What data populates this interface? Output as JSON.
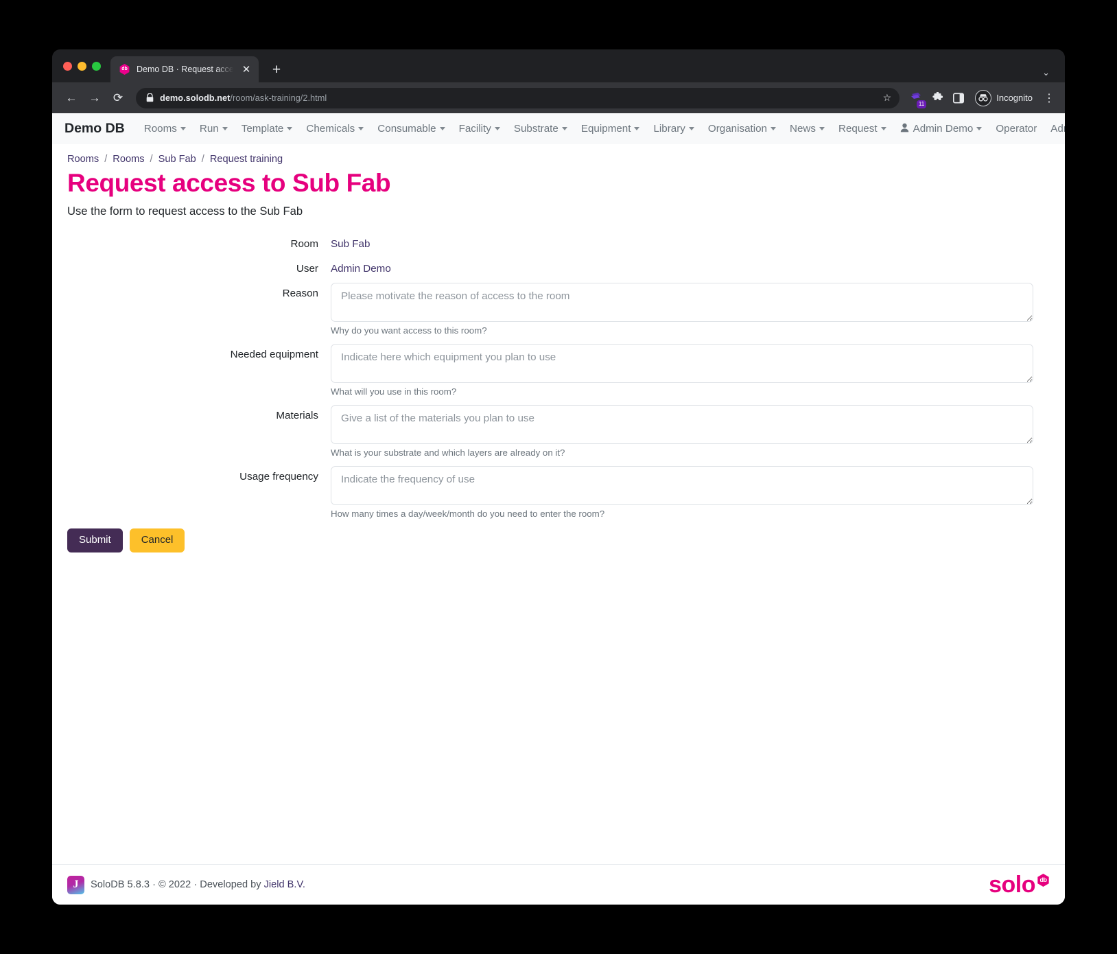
{
  "browser": {
    "tab": {
      "title": "Demo DB · Request access to S",
      "favicon": "solodb-icon",
      "close_label": "✕"
    },
    "new_tab_label": "+",
    "tabstrip_chevron": "⌄",
    "toolbar": {
      "back": "←",
      "forward": "→",
      "reload": "⟳",
      "url_bold": "demo.solodb.net",
      "url_rest": "/room/ask-training/2.html",
      "bookmark": "☆",
      "extension_badge": "11",
      "incognito_label": "Incognito",
      "menu": "⋮"
    }
  },
  "navbar": {
    "brand": "Demo DB",
    "items": [
      {
        "label": "Rooms",
        "caret": true
      },
      {
        "label": "Run",
        "caret": true
      },
      {
        "label": "Template",
        "caret": true
      },
      {
        "label": "Chemicals",
        "caret": true
      },
      {
        "label": "Consumable",
        "caret": true
      },
      {
        "label": "Facility",
        "caret": true
      },
      {
        "label": "Substrate",
        "caret": true
      },
      {
        "label": "Equipment",
        "caret": true
      },
      {
        "label": "Library",
        "caret": true
      },
      {
        "label": "Organisation",
        "caret": true
      },
      {
        "label": "News",
        "caret": true
      },
      {
        "label": "Request",
        "caret": true
      }
    ],
    "right_items": [
      {
        "label": "Admin Demo",
        "caret": true,
        "icon": "person-icon"
      },
      {
        "label": "Operator",
        "caret": false
      },
      {
        "label": "Admin",
        "caret": false
      }
    ]
  },
  "breadcrumb": [
    "Rooms",
    "Rooms",
    "Sub Fab",
    "Request training"
  ],
  "page": {
    "title": "Request access to Sub Fab",
    "subtitle": "Use the form to request access to the Sub Fab",
    "title_color": "#e6007e"
  },
  "form": {
    "rows": [
      {
        "label": "Room",
        "type": "static",
        "value": "Sub Fab"
      },
      {
        "label": "User",
        "type": "static",
        "value": "Admin Demo"
      },
      {
        "label": "Reason",
        "type": "textarea",
        "value": "",
        "placeholder": "Please motivate the reason of access to the room",
        "help": "Why do you want access to this room?"
      },
      {
        "label": "Needed equipment",
        "type": "textarea",
        "value": "",
        "placeholder": "Indicate here which equipment you plan to use",
        "help": "What will you use in this room?"
      },
      {
        "label": "Materials",
        "type": "textarea",
        "value": "",
        "placeholder": "Give a list of the materials you plan to use",
        "help": "What is your substrate and which layers are already on it?"
      },
      {
        "label": "Usage frequency",
        "type": "textarea",
        "value": "",
        "placeholder": "Indicate the frequency of use",
        "help": "How many times a day/week/month do you need to enter the room?"
      }
    ],
    "submit_label": "Submit",
    "cancel_label": "Cancel",
    "submit_color": "#442c55",
    "cancel_color": "#fdc02a"
  },
  "footer": {
    "app": "SoloDB 5.8.3",
    "copyright": "© 2022",
    "developed_by": "Developed by",
    "developer": "Jield B.V.",
    "separator": "·",
    "logo_text": "solo",
    "logo_badge": "db"
  }
}
